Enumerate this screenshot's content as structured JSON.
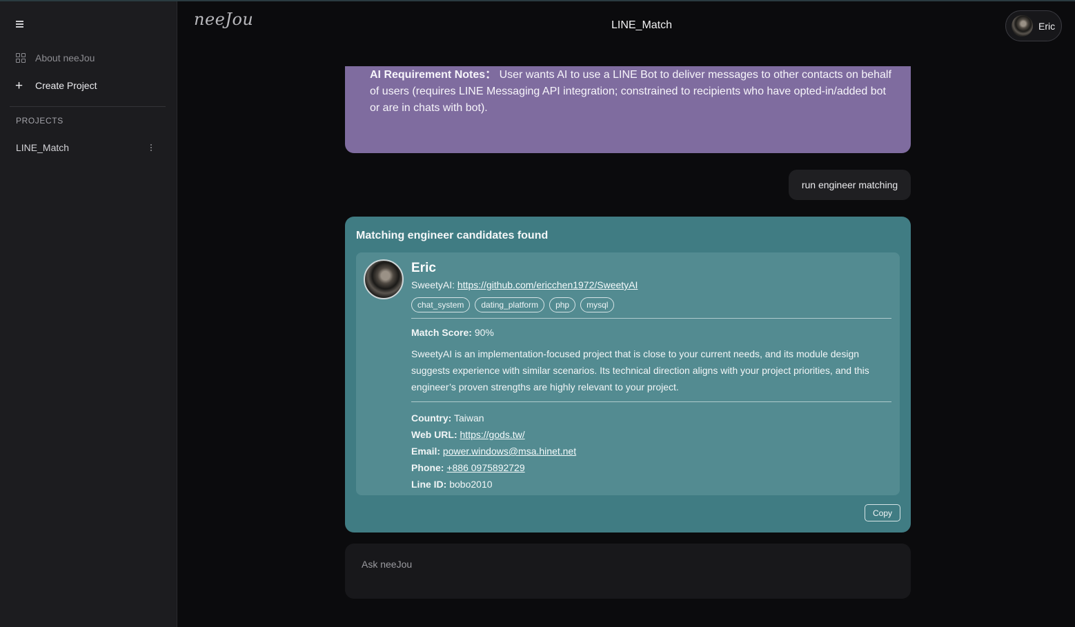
{
  "sidebar": {
    "items": [
      {
        "label": "About neeJou",
        "icon": "grid-icon"
      },
      {
        "label": "Create Project",
        "icon": "plus-icon"
      }
    ],
    "projects_header": "PROJECTS",
    "projects": [
      {
        "label": "LINE_Match"
      }
    ]
  },
  "header": {
    "logo_text": "neeJou",
    "title": "LINE_Match",
    "user_name": "Eric"
  },
  "notes": {
    "label": "AI Requirement Notes：",
    "text": "User wants AI to use a LINE Bot to deliver messages to other contacts on behalf of users (requires LINE Messaging API integration; constrained to recipients who have opted-in/added bot or are in chats with bot)."
  },
  "user_message": "run engineer matching",
  "result": {
    "title": "Matching engineer candidates found",
    "candidate": {
      "name": "Eric",
      "repo_name": "SweetyAI:",
      "repo_url": "https://github.com/ericchen1972/SweetyAI",
      "tags": [
        "chat_system",
        "dating_platform",
        "php",
        "mysql"
      ],
      "score_label": "Match Score:",
      "score_value": "90%",
      "description": "SweetyAI is an implementation-focused project that is close to your current needs, and its module design suggests experience with similar scenarios. Its technical direction aligns with your project priorities, and this engineer’s proven strengths are highly relevant to your project.",
      "country_label": "Country:",
      "country": "Taiwan",
      "web_label": "Web URL:",
      "web_url": "https://gods.tw/",
      "email_label": "Email:",
      "email": "power.windows@msa.hinet.net",
      "phone_label": "Phone:",
      "phone": "+886 0975892729",
      "line_label": "Line ID:",
      "line_id": "bobo2010"
    },
    "copy_label": "Copy"
  },
  "input": {
    "placeholder": "Ask neeJou"
  },
  "colors": {
    "notes_bg": "#7f6c9f",
    "result_bg": "#407c83",
    "candidate_bg": "#538b91",
    "sidebar_bg": "#1c1c1f",
    "page_bg": "#0b0b0d"
  }
}
